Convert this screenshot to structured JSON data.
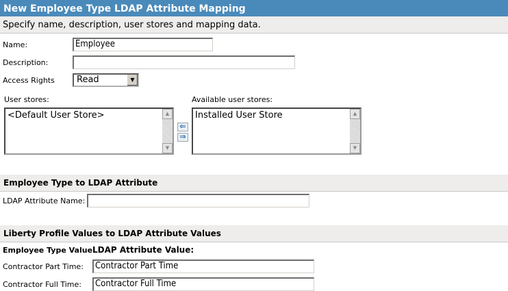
{
  "dialog": {
    "title": "New Employee Type LDAP Attribute Mapping",
    "subtitle": "Specify name, description, user stores and mapping data."
  },
  "form": {
    "name_label": "Name:",
    "name_value": "Employee",
    "description_label": "Description:",
    "description_value": "",
    "access_rights_label": "Access Rights",
    "access_rights_value": "Read",
    "user_stores_label": "User stores:",
    "user_stores": [
      "<Default User Store>"
    ],
    "available_stores_label": "Available user stores:",
    "available_stores": [
      "Installed User Store"
    ],
    "move_left_icon": "arrow-left-icon",
    "move_right_icon": "arrow-right-icon"
  },
  "ldap_section": {
    "title": "Employee Type to LDAP Attribute",
    "attr_name_label": "LDAP Attribute Name:",
    "attr_name_value": ""
  },
  "mapping_section": {
    "title": "Liberty Profile Values to LDAP Attribute Values",
    "col1": "Employee Type Value:",
    "col2": "LDAP Attribute Value:",
    "rows": [
      {
        "label": "Contractor Part Time:",
        "value": "Contractor Part Time"
      },
      {
        "label": "Contractor Full Time:",
        "value": "Contractor Full Time"
      }
    ]
  }
}
